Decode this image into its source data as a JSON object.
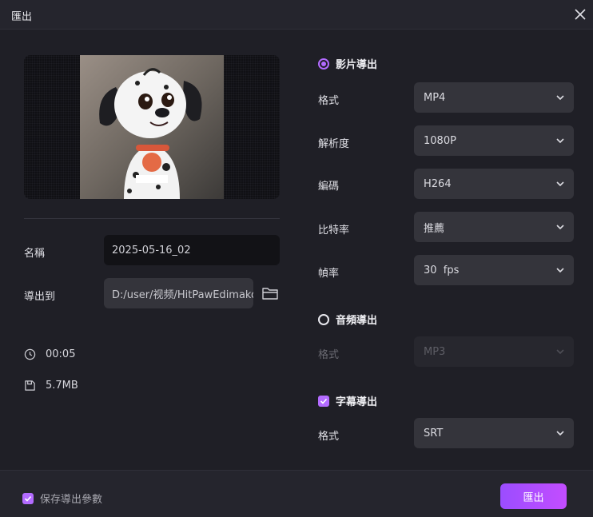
{
  "window": {
    "title": "匯出"
  },
  "preview": {
    "image": "dalmatian-puppy-cartoon"
  },
  "left": {
    "name_label": "名稱",
    "name_value": "2025-05-16_02",
    "export_to_label": "導出到",
    "export_path": "D:/user/视频/HitPawEdimakor",
    "duration": "00:05",
    "file_size": "5.7MB"
  },
  "video_export": {
    "title": "影片導出",
    "selected": true,
    "format_label": "格式",
    "format_value": "MP4",
    "resolution_label": "解析度",
    "resolution_value": "1080P",
    "codec_label": "編碼",
    "codec_value": "H264",
    "bitrate_label": "比特率",
    "bitrate_value": "推薦",
    "framerate_label": "幀率",
    "framerate_value": "30  fps"
  },
  "audio_export": {
    "title": "音頻導出",
    "selected": false,
    "format_label": "格式",
    "format_value": "MP3"
  },
  "subtitle_export": {
    "title": "字幕導出",
    "checked": true,
    "format_label": "格式",
    "format_value": "SRT"
  },
  "footer": {
    "save_params_label": "保存導出參數",
    "save_params_checked": true,
    "export_button": "匯出"
  },
  "colors": {
    "accent": "#b36bff",
    "background": "#1f1f26",
    "field": "#34343b"
  }
}
